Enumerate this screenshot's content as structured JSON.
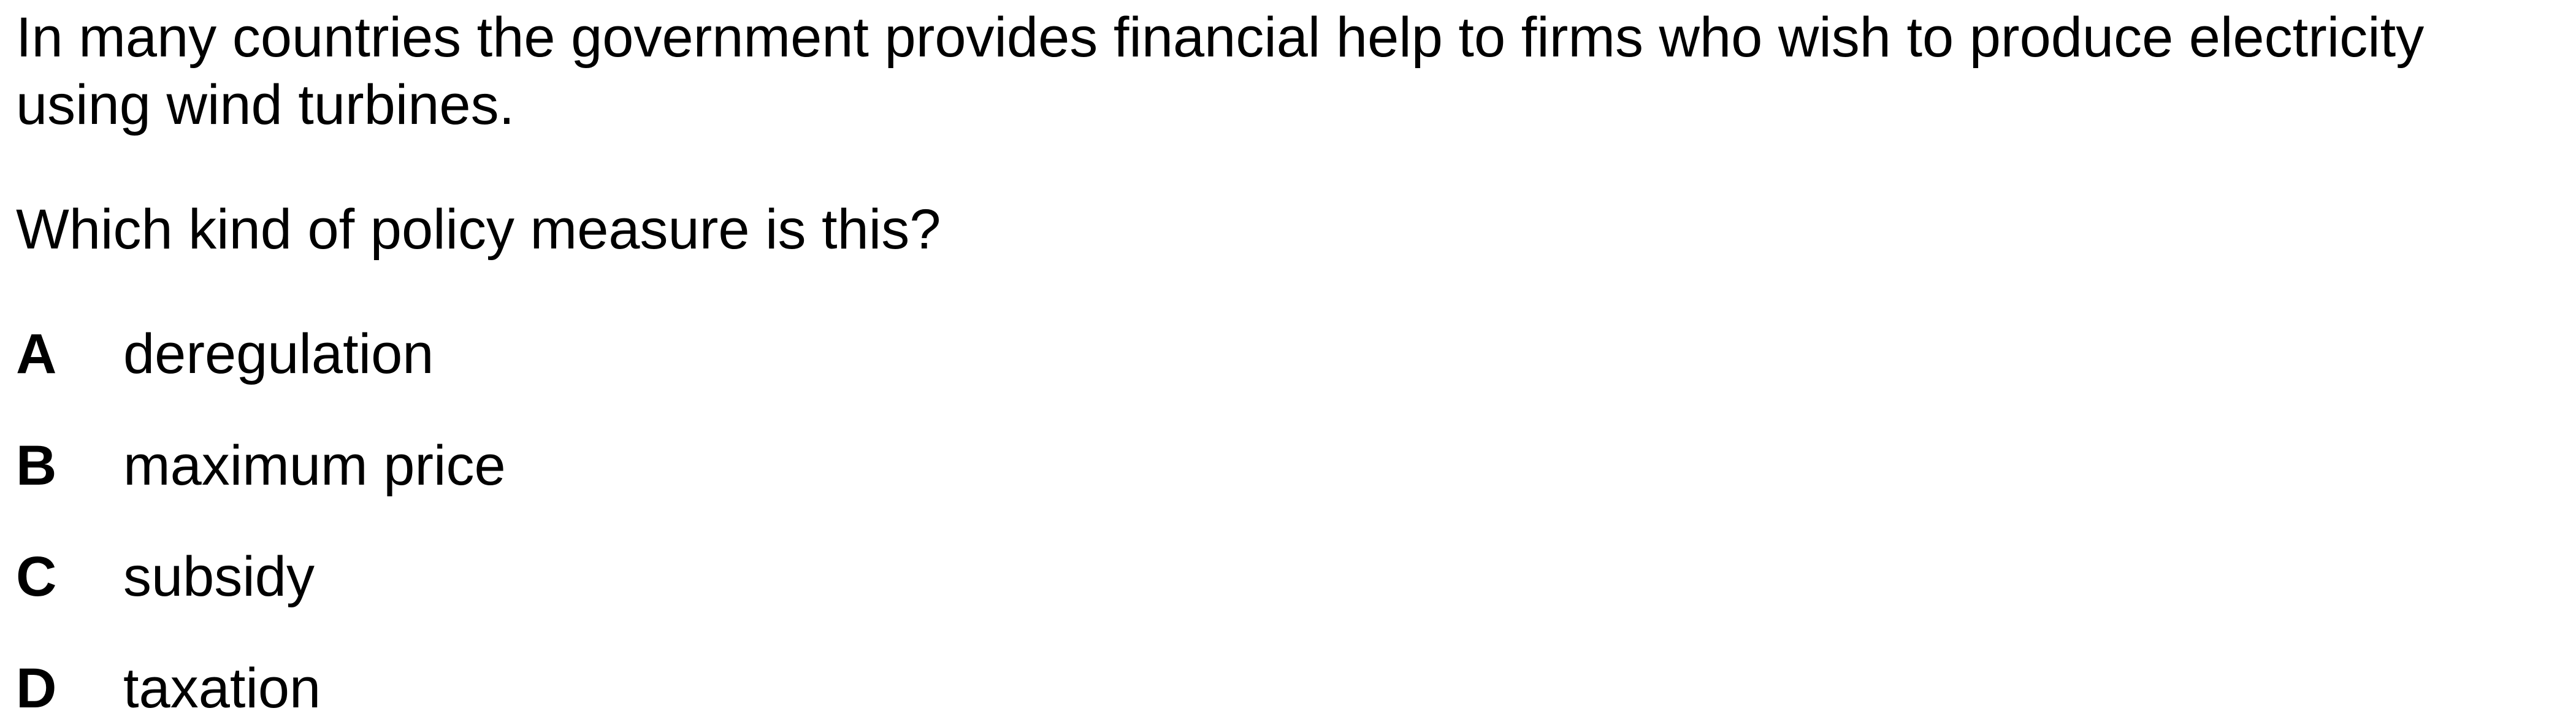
{
  "question": {
    "stem": "In many countries the government provides financial help to firms who wish to produce electricity using wind turbines.",
    "prompt": "Which kind of policy measure is this?",
    "options": [
      {
        "letter": "A",
        "text": "deregulation"
      },
      {
        "letter": "B",
        "text": "maximum price"
      },
      {
        "letter": "C",
        "text": "subsidy"
      },
      {
        "letter": "D",
        "text": "taxation"
      }
    ]
  }
}
